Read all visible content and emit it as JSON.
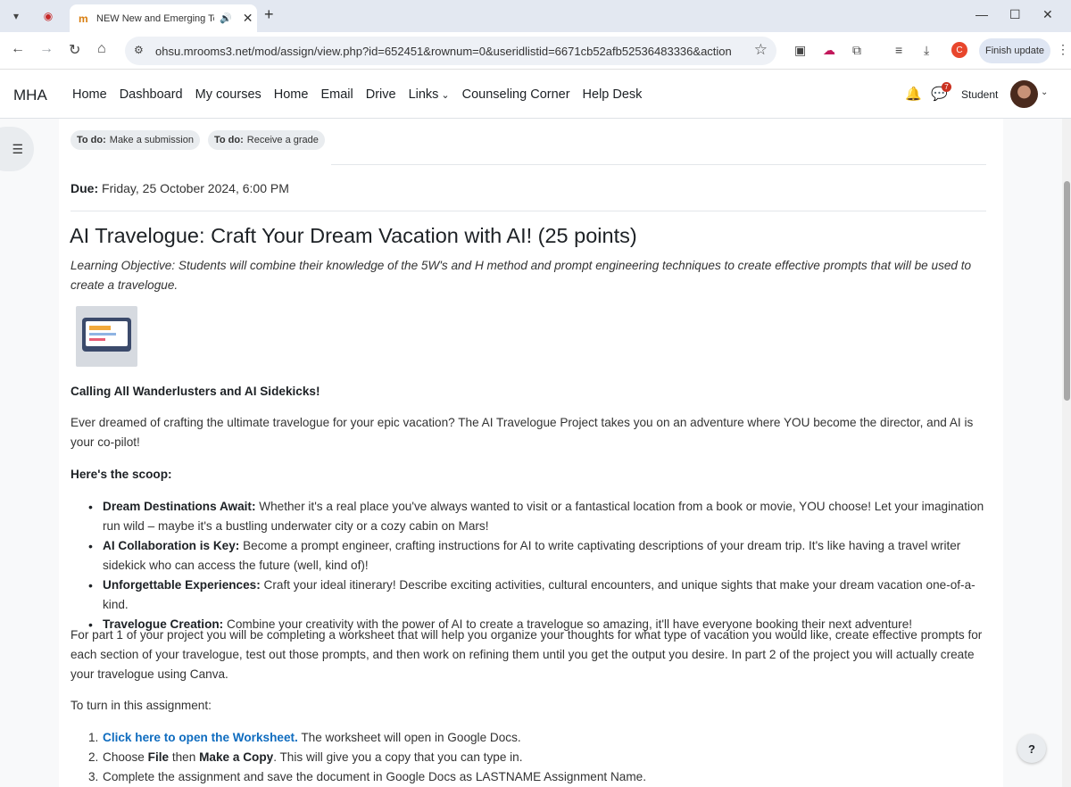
{
  "browser": {
    "tab_title": "NEW New and Emerging Te",
    "tab_favicon": "m",
    "url": "ohsu.mrooms3.net/mod/assign/view.php?id=652451&rownum=0&useridlistid=6671cb52afb52536483336&action",
    "profile_initial": "C",
    "finish_update_label": "Finish update",
    "icons": {
      "tab_menu": "▾",
      "record": "◉",
      "speaker": "🔊",
      "close_tab": "✕",
      "new_tab": "+",
      "minimize": "—",
      "maximize": "☐",
      "close_window": "✕",
      "back": "←",
      "forward": "→",
      "reload": "↻",
      "home": "⌂",
      "site_info": "⚙",
      "bookmark": "☆",
      "cast": "▣",
      "extension_a": "☁",
      "extensions": "⧉",
      "media": "≡",
      "download": "⤓",
      "menu": "⋮"
    }
  },
  "nav": {
    "brand": "MHA",
    "links": [
      "Home",
      "Dashboard",
      "My courses",
      "Home",
      "Email",
      "Drive",
      "Links",
      "Counseling Corner",
      "Help Desk"
    ],
    "links_dropdown_caret": "⌄",
    "bell_icon": "🔔",
    "message_icon": "💬",
    "message_count": "7",
    "user_name": "Student",
    "avatar_caret": "⌄"
  },
  "page": {
    "drawer_icon": "☰",
    "todo": [
      {
        "label": "To do:",
        "text": "Make a submission"
      },
      {
        "label": "To do:",
        "text": "Receive a grade"
      }
    ],
    "due_label": "Due:",
    "due_value": "Friday, 25 October 2024, 6:00 PM",
    "title": "AI Travelogue:  Craft Your Dream Vacation with AI! (25 points)",
    "objective": "Learning Objective: Students will combine their knowledge of the 5W's and H method and prompt engineering techniques to create effective prompts that will be used to create a travelogue.",
    "calling": "Calling All Wanderlusters and AI Sidekicks!",
    "intro": "Ever dreamed of crafting the ultimate travelogue for your epic vacation?  The AI Travelogue Project takes you on an adventure where YOU become the director, and AI is your co-pilot!",
    "scoop": "Here's the scoop:",
    "bullets": [
      {
        "bold": "Dream Destinations Await:",
        "text": " Whether it's a real place you've always wanted to visit or a fantastical location from a book or movie, YOU choose! Let your imagination run wild – maybe it's a bustling underwater city or a cozy cabin on Mars!"
      },
      {
        "bold": "AI Collaboration is Key:",
        "text": " Become a prompt engineer, crafting instructions for AI to write captivating descriptions of your dream trip. It's like having a travel writer sidekick who can access the future (well, kind of)!"
      },
      {
        "bold": "Unforgettable Experiences:",
        "text": " Craft your ideal itinerary! Describe exciting activities, cultural encounters, and unique sights that make your dream vacation one-of-a-kind."
      },
      {
        "bold": "Travelogue Creation:",
        "text": " Combine your creativity with the power of AI to create a travelogue so amazing, it'll have everyone booking their next adventure!"
      }
    ],
    "part_text": "For part 1 of your project you will be completing a worksheet that will help you organize your thoughts for what type of vacation you would like, create effective prompts for each section of your travelogue, test out those prompts, and then work on refining them until you get the output you desire.  In part 2 of the project you will actually create your travelogue using Canva.",
    "turn_in": "To turn in this assignment:",
    "steps": {
      "s1_num": "1.",
      "s1_link": "Click here to open the Worksheet.",
      "s1_rest": " The worksheet will open in Google Docs.",
      "s2_num": "2.",
      "s2_a": "Choose ",
      "s2_file": "File",
      "s2_b": " then ",
      "s2_copy": "Make a Copy",
      "s2_c": ". This will give you a copy that you can type in.",
      "s3_num": "3.",
      "s3_text": "Complete the assignment and save the document in Google Docs as LASTNAME Assignment Name."
    },
    "help_label": "?"
  },
  "colors": {
    "link": "#0f6cbf",
    "badge_bg": "#e9ecef",
    "notify": "#ca3120"
  }
}
